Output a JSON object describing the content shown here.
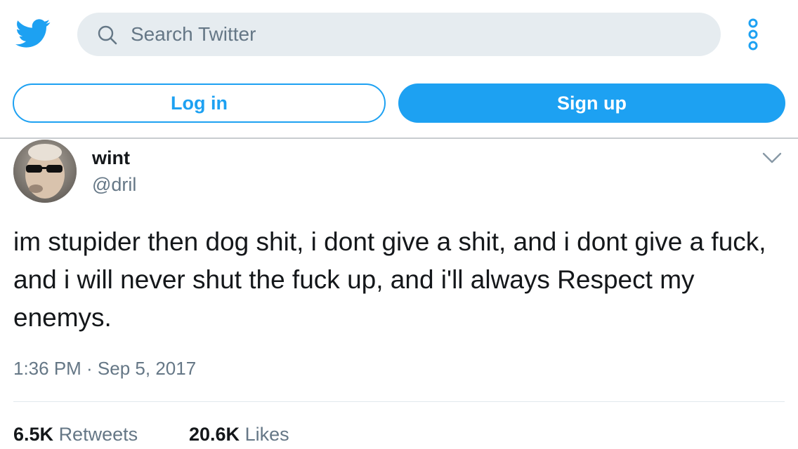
{
  "header": {
    "search_placeholder": "Search Twitter",
    "brand_color": "#1da1f2"
  },
  "auth": {
    "login_label": "Log in",
    "signup_label": "Sign up"
  },
  "tweet": {
    "display_name": "wint",
    "handle": "@dril",
    "text": "im stupider then dog shit, i dont give a shit, and i dont give a fuck, and i will never shut the fuck up, and i'll always Respect my enemys.",
    "timestamp": "1:36 PM · Sep 5, 2017",
    "retweets_count": "6.5K",
    "retweets_label": "Retweets",
    "likes_count": "20.6K",
    "likes_label": "Likes"
  },
  "icons": {
    "logo": "twitter-bird-icon",
    "search": "search-icon",
    "more": "more-vertical-icon",
    "menu": "chevron-down-icon"
  }
}
